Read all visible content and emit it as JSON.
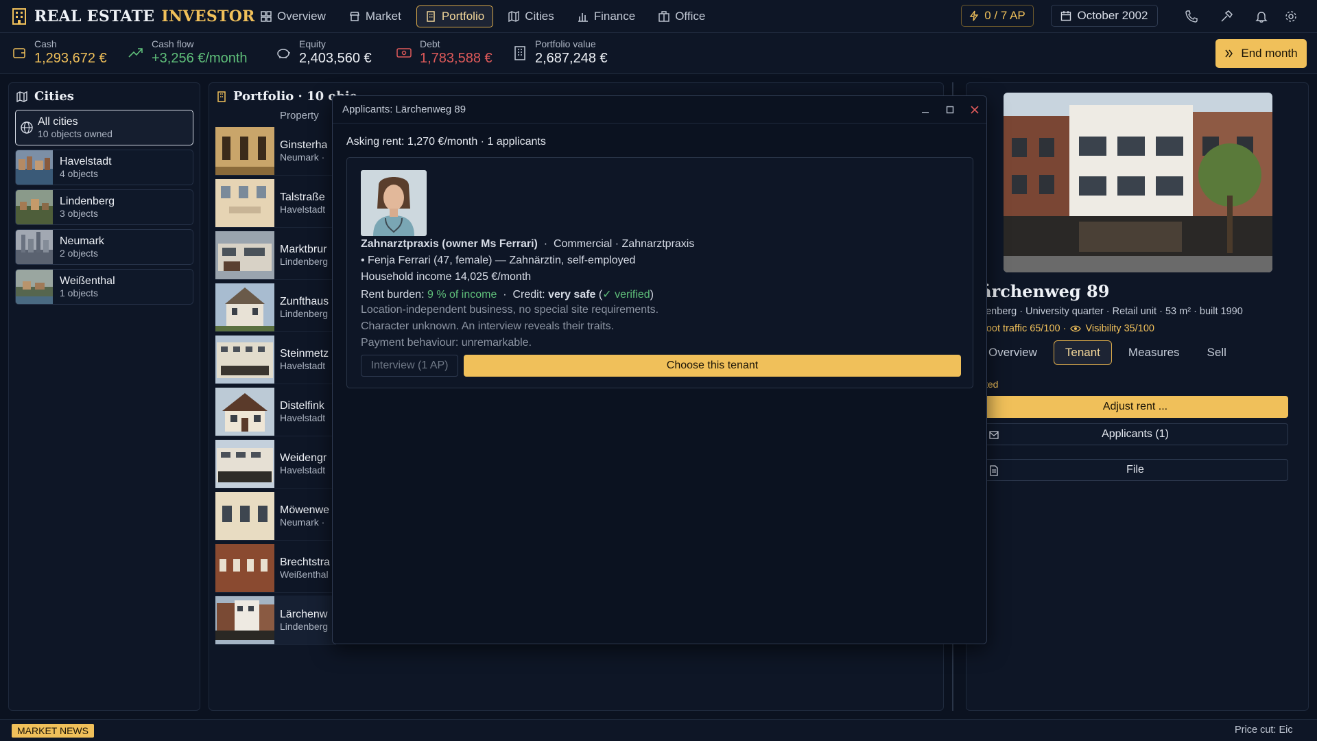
{
  "app": {
    "brand_main": "REAL ESTATE",
    "brand_accent": "INVESTOR"
  },
  "nav": [
    {
      "label": "Overview",
      "icon": "dashboard-icon"
    },
    {
      "label": "Market",
      "icon": "store-icon"
    },
    {
      "label": "Portfolio",
      "icon": "building-icon",
      "active": true
    },
    {
      "label": "Cities",
      "icon": "map-icon"
    },
    {
      "label": "Finance",
      "icon": "bar-chart-icon"
    },
    {
      "label": "Office",
      "icon": "office-icon"
    }
  ],
  "action_points": "0 / 7 AP",
  "current_date": "October 2002",
  "stats": {
    "cash": {
      "label": "Cash",
      "value": "1,293,672 €"
    },
    "cashflow": {
      "label": "Cash flow",
      "value": "+3,256 €/month"
    },
    "equity": {
      "label": "Equity",
      "value": "2,403,560 €"
    },
    "debt": {
      "label": "Debt",
      "value": "1,783,588 €"
    },
    "portfolio_value": {
      "label": "Portfolio value",
      "value": "2,687,248 €"
    }
  },
  "end_month_label": "End month",
  "cities_panel": {
    "title": "Cities",
    "items": [
      {
        "name": "All cities",
        "count": "10 objects owned"
      },
      {
        "name": "Havelstadt",
        "count": "4 objects"
      },
      {
        "name": "Lindenberg",
        "count": "3 objects"
      },
      {
        "name": "Neumark",
        "count": "2 objects"
      },
      {
        "name": "Weißenthal",
        "count": "1 objects"
      }
    ]
  },
  "portfolio_panel": {
    "title": "Portfolio · 10 obje",
    "column_header": "Property",
    "rows": [
      {
        "name": "Ginsterha",
        "city": "Neumark ·"
      },
      {
        "name": "Talstraße",
        "city": "Havelstadt"
      },
      {
        "name": "Marktbrur",
        "city": "Lindenberg"
      },
      {
        "name": "Zunfthaus",
        "city": "Lindenberg"
      },
      {
        "name": "Steinmetz",
        "city": "Havelstadt"
      },
      {
        "name": "Distelfink",
        "city": "Havelstadt"
      },
      {
        "name": "Weidengr",
        "city": "Havelstadt"
      },
      {
        "name": "Möwenwe",
        "city": "Neumark ·"
      },
      {
        "name": "Brechtstra",
        "city": "Weißenthal"
      },
      {
        "name": "Lärchenw",
        "city": "Lindenberg"
      }
    ]
  },
  "modal": {
    "title": "Applicants: Lärchenweg 89",
    "asking": "Asking rent: 1,270 €/month · 1 applicants",
    "applicant": {
      "name": "Zahnarztpraxis (owner Ms Ferrari)",
      "type": "Commercial · Zahnarztpraxis",
      "person": "• Fenja Ferrari (47, female) — Zahnärztin, self-employed",
      "income": "Household income 14,025 €/month",
      "burden_label": "Rent burden:",
      "burden_value": "9 % of income",
      "credit_label": "Credit:",
      "credit_value": "very safe",
      "verified": "✓ verified",
      "note1": "Location-independent business, no special site requirements.",
      "note2": "Character unknown. An interview reveals their traits.",
      "note3": "Payment behaviour: unremarkable."
    },
    "interview_label": "Interview (1 AP)",
    "choose_label": "Choose this tenant"
  },
  "detail": {
    "title": "ärchenweg 89",
    "meta": "denberg · University quarter  ·  Retail unit  ·  53 m²  ·  built 1990",
    "foot_traffic": "Foot traffic 65/100 ·",
    "visibility": "Visibility 35/100",
    "tabs": [
      "Overview",
      "Tenant",
      "Measures",
      "Sell"
    ],
    "active_tab": "Tenant",
    "status": "ted",
    "adjust_rent": "Adjust rent ...",
    "applicants": "Applicants (1)",
    "file": "File"
  },
  "footer": {
    "badge": "MARKET NEWS",
    "ticker": "Price cut: Eic"
  },
  "colors": {
    "accent": "#f0c05a",
    "positive": "#5fbf7a",
    "negative": "#e05a5a",
    "background": "#0b1220"
  }
}
